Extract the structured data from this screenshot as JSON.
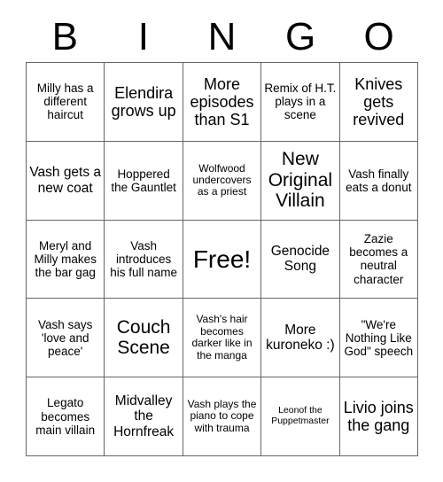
{
  "card": {
    "header_letters": [
      "B",
      "I",
      "N",
      "G",
      "O"
    ],
    "grid": {
      "columns": 5,
      "rows": 5,
      "border_color": "#666666",
      "text_color": "#000000",
      "background_color": "#ffffff"
    },
    "cells": [
      {
        "text": "Milly has a different haircut",
        "size": "md",
        "column": "B",
        "row": 1
      },
      {
        "text": "Elendira grows up",
        "size": "xl",
        "column": "I",
        "row": 1
      },
      {
        "text": "More episodes than S1",
        "size": "xl",
        "column": "N",
        "row": 1
      },
      {
        "text": "Remix of H.T. plays in a scene",
        "size": "md",
        "column": "G",
        "row": 1
      },
      {
        "text": "Knives gets revived",
        "size": "xl",
        "column": "O",
        "row": 1
      },
      {
        "text": "Vash gets a new coat",
        "size": "lg",
        "column": "B",
        "row": 2
      },
      {
        "text": "Hoppered the Gauntlet",
        "size": "md",
        "column": "I",
        "row": 2
      },
      {
        "text": "Wolfwood undercovers as a priest",
        "size": "sm",
        "column": "N",
        "row": 2
      },
      {
        "text": "New Original Villain",
        "size": "xxl",
        "column": "G",
        "row": 2
      },
      {
        "text": "Vash finally eats a donut",
        "size": "md",
        "column": "O",
        "row": 2
      },
      {
        "text": "Meryl and Milly makes the bar gag",
        "size": "md",
        "column": "B",
        "row": 3
      },
      {
        "text": "Vash introduces his full name",
        "size": "md",
        "column": "I",
        "row": 3
      },
      {
        "text": "Free!",
        "size": "free",
        "column": "N",
        "row": 3
      },
      {
        "text": "Genocide Song",
        "size": "lg",
        "column": "G",
        "row": 3
      },
      {
        "text": "Zazie becomes a neutral character",
        "size": "md",
        "column": "O",
        "row": 3
      },
      {
        "text": "Vash says 'love and peace'",
        "size": "md",
        "column": "B",
        "row": 4
      },
      {
        "text": "Couch Scene",
        "size": "xxl",
        "column": "I",
        "row": 4
      },
      {
        "text": "Vash's hair becomes darker like in the manga",
        "size": "sm",
        "column": "N",
        "row": 4
      },
      {
        "text": "More kuroneko :)",
        "size": "lg",
        "column": "G",
        "row": 4
      },
      {
        "text": "\"We're Nothing Like God\" speech",
        "size": "md",
        "column": "O",
        "row": 4
      },
      {
        "text": "Legato becomes main villain",
        "size": "md",
        "column": "B",
        "row": 5
      },
      {
        "text": "Midvalley the Hornfreak",
        "size": "lg",
        "column": "I",
        "row": 5
      },
      {
        "text": "Vash plays the piano to cope with trauma",
        "size": "sm",
        "column": "N",
        "row": 5
      },
      {
        "text": "Leonof the Puppetmaster",
        "size": "xs",
        "column": "G",
        "row": 5
      },
      {
        "text": "Livio joins the gang",
        "size": "xl",
        "column": "O",
        "row": 5
      }
    ]
  }
}
